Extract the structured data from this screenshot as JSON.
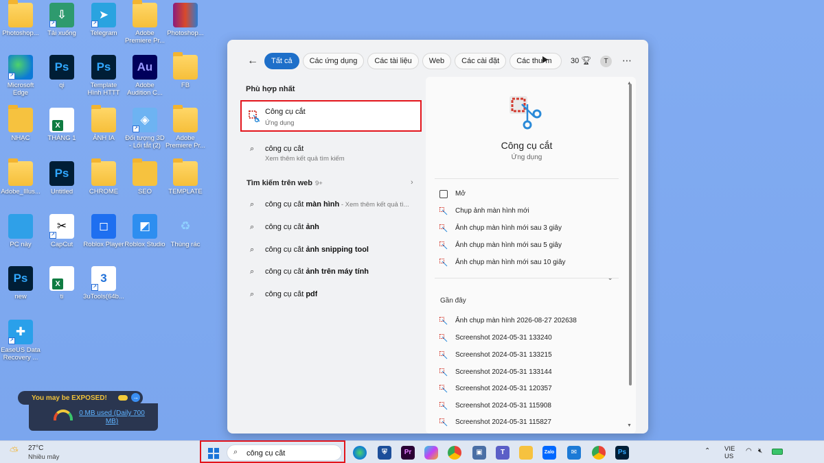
{
  "desktop": {
    "icons": [
      {
        "label": "Photoshop..."
      },
      {
        "label": "Tải xuống"
      },
      {
        "label": "Telegram"
      },
      {
        "label": "Adobe Premiere Pr..."
      },
      {
        "label": "Photoshop..."
      },
      {
        "label": "Microsoft Edge"
      },
      {
        "label": "qi"
      },
      {
        "label": "Template Hình HTTT"
      },
      {
        "label": "Adobe Audition C..."
      },
      {
        "label": "FB"
      },
      {
        "label": "NHẠC"
      },
      {
        "label": "THÁNG 1"
      },
      {
        "label": "ẢNH IA"
      },
      {
        "label": "Đối tượng 3D - Lối tắt (2)"
      },
      {
        "label": "Adobe Premiere Pr..."
      },
      {
        "label": "Adobe_Illus..."
      },
      {
        "label": "Untitled"
      },
      {
        "label": "CHROME"
      },
      {
        "label": "SEO"
      },
      {
        "label": "TEMPLATE"
      },
      {
        "label": "PC này"
      },
      {
        "label": "CapCut"
      },
      {
        "label": "Roblox Player"
      },
      {
        "label": "Roblox Studio"
      },
      {
        "label": "Thùng rác"
      },
      {
        "label": "new"
      },
      {
        "label": "ti"
      },
      {
        "label": "3uTools(64b..."
      },
      {
        "label": "EaseUS Data Recovery ..."
      }
    ],
    "widget": {
      "warning": "You may be EXPOSED!",
      "usage": "0 MB used (Daily 700 MB)"
    }
  },
  "search_panel": {
    "tabs": [
      "Tất cả",
      "Các ứng dụng",
      "Các tài liệu",
      "Web",
      "Các cài đặt",
      "Các thư m"
    ],
    "points": "30",
    "avatar": "T",
    "best_match_title": "Phù hợp nhất",
    "best_match": {
      "name": "Công cụ cắt",
      "type": "Ứng dụng"
    },
    "search_row": {
      "query": "công cụ cắt",
      "hint": "Xem thêm kết quả tìm kiếm"
    },
    "web_title": "Tìm kiếm trên web",
    "web_count": "9+",
    "web_results": [
      {
        "prefix": "công cụ cắt ",
        "bold": "màn hình",
        "suffix": " - Xem thêm kết quả tì..."
      },
      {
        "prefix": "công cụ cắt ",
        "bold": "ảnh",
        "suffix": ""
      },
      {
        "prefix": "công cụ cắt ",
        "bold": "ảnh snipping tool",
        "suffix": ""
      },
      {
        "prefix": "công cụ cắt ",
        "bold": "ảnh trên máy tính",
        "suffix": ""
      },
      {
        "prefix": "công cụ cắt ",
        "bold": "pdf",
        "suffix": ""
      }
    ],
    "detail": {
      "name": "Công cụ cắt",
      "type": "Ứng dụng",
      "actions": [
        "Mở",
        "Chụp ảnh màn hình mới",
        "Ảnh chụp màn hình mới sau 3 giây",
        "Ảnh chụp màn hình mới sau 5 giây",
        "Ảnh chụp màn hình mới sau 10 giây"
      ],
      "recent_title": "Gần đây",
      "recent": [
        "Ảnh chụp màn hình 2026-08-27 202638",
        "Screenshot 2024-05-31 133240",
        "Screenshot 2024-05-31 133215",
        "Screenshot 2024-05-31 133144",
        "Screenshot 2024-05-31 120357",
        "Screenshot 2024-05-31 115908",
        "Screenshot 2024-05-31 115827"
      ]
    }
  },
  "taskbar": {
    "temperature": "27°C",
    "condition": "Nhiều mây",
    "search_value": "công cụ cắt",
    "apps": [
      "edge-icon",
      "defender-icon",
      "premiere-icon",
      "copilot-icon",
      "chrome-icon",
      "device-icon",
      "teams-icon",
      "explorer-icon",
      "zalo-icon",
      "mail-icon",
      "chrome-alt-icon",
      "photoshop-icon"
    ],
    "lang_top": "VIE",
    "lang_bottom": "US"
  },
  "colors": {
    "accent": "#1e6fc9",
    "highlight": "#e3141b",
    "desktop": "#7fa9ef"
  }
}
